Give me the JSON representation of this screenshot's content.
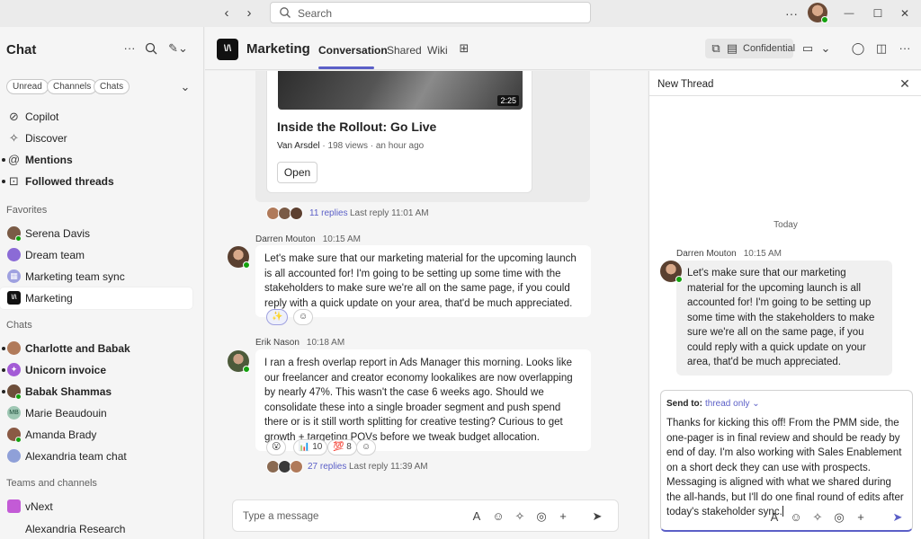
{
  "titlebar": {
    "search_placeholder": "Search",
    "more_glyph": "···",
    "minimize_glyph": "—",
    "maximize_glyph": "☐",
    "close_glyph": "✕"
  },
  "sidebar": {
    "title": "Chat",
    "filters": [
      "Unread",
      "Channels",
      "Chats"
    ],
    "quick": [
      {
        "label": "Copilot",
        "icon": "copilot-icon",
        "bold": false,
        "unread": false
      },
      {
        "label": "Discover",
        "icon": "sparkle-icon",
        "bold": false,
        "unread": false
      },
      {
        "label": "Mentions",
        "icon": "at-icon",
        "bold": true,
        "unread": true
      },
      {
        "label": "Followed threads",
        "icon": "threads-icon",
        "bold": true,
        "unread": true
      }
    ],
    "favorites_label": "Favorites",
    "favorites": [
      {
        "label": "Serena Davis",
        "color": "#7a5b46",
        "bold": false
      },
      {
        "label": "Dream team",
        "color": "#8b6bd6",
        "bold": false
      },
      {
        "label": "Marketing team sync",
        "color": "#9fa1e0",
        "bold": false
      },
      {
        "label": "Marketing",
        "color": "#111111",
        "bold": false,
        "selected": true
      }
    ],
    "chats_label": "Chats",
    "chats": [
      {
        "label": "Charlotte and Babak",
        "color": "#b07a5a",
        "bold": true,
        "unread": true
      },
      {
        "label": "Unicorn invoice",
        "color": "#a35bd6",
        "bold": true,
        "unread": true
      },
      {
        "label": "Babak Shammas",
        "color": "#6d4e3a",
        "bold": true,
        "unread": true
      },
      {
        "label": "Marie Beaudouin",
        "color": "#9ec7b3",
        "bold": false,
        "initials": "MB"
      },
      {
        "label": "Amanda Brady",
        "color": "#8a5a44",
        "bold": false
      },
      {
        "label": "Alexandria team chat",
        "color": "#8fa0d8",
        "bold": false
      }
    ],
    "teams_label": "Teams and channels",
    "teams": [
      {
        "label": "vNext",
        "color": "#c35bd6"
      },
      {
        "label": "Alexandria Research",
        "color": "#f5f5f5"
      }
    ]
  },
  "header": {
    "logo_text": "\\/\\",
    "team_name": "Marketing",
    "tabs": [
      "Conversation",
      "Shared",
      "Wiki"
    ],
    "confidential": "Confidential"
  },
  "conversation": {
    "card": {
      "duration": "2:25",
      "title": "Inside the Rollout: Go Live",
      "author": "Van Arsdel",
      "meta": " · 198 views · an hour ago",
      "open_label": "Open"
    },
    "thread1": {
      "replies": "11 replies",
      "last": "Last reply 11:01 AM"
    },
    "msg1": {
      "author": "Darren Mouton",
      "time": "10:15 AM",
      "text": "Let's make sure that our marketing material for the upcoming launch is all accounted for! I'm going to be setting up some time with the stakeholders to make sure we're all on the same page, if you could reply with a quick update on your area, that'd be much appreciated."
    },
    "msg2": {
      "author": "Erik Nason",
      "time": "10:18 AM",
      "text": "I ran a fresh overlap report in Ads Manager this morning. Looks like our freelancer and creator economy lookalikes are now overlapping by nearly 47%. This wasn't the case 6 weeks ago. Should we consolidate these into a single broader segment and push spend there or is it still worth splitting for creative testing? Curious to get growth + targeting POVs before we tweak budget allocation.",
      "reactions": [
        {
          "emoji": "😮",
          "count": ""
        },
        {
          "emoji": "📊",
          "count": "10"
        },
        {
          "emoji": "💯",
          "count": "8"
        }
      ]
    },
    "thread2": {
      "replies": "27 replies",
      "last": "Last reply 11:39 AM"
    },
    "compose_placeholder": "Type a message"
  },
  "thread": {
    "title": "New Thread",
    "today": "Today",
    "author": "Darren Mouton",
    "time": "10:15 AM",
    "text": "Let's make sure that our marketing material for the upcoming launch is all accounted for! I'm going to be setting up some time with the stakeholders to make sure we're all on the same page, if you could reply with a quick update on your area, that'd be much appreciated.",
    "send_to_label": "Send to:",
    "send_to_value": "thread only",
    "draft": "Thanks for kicking this off! From the PMM side, the one-pager is in final review and should be ready by end of day. I'm also working with Sales Enablement on a short deck they can use with prospects. Messaging is aligned with what we shared during the all-hands, but I'll do one final round of edits after today's stakeholder sync."
  },
  "colors": {
    "accent": "#5b5fc7",
    "presence": "#13a10e"
  }
}
